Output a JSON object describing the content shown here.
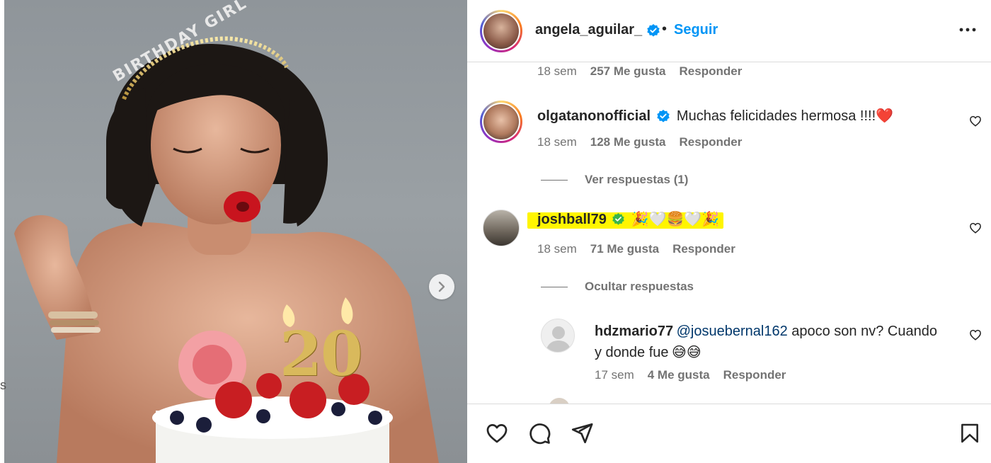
{
  "post": {
    "author": "angela_aguilar_",
    "dot": "•",
    "follow_label": "Seguir",
    "photo": {
      "crown_text": "BIRTHDAY GIRL",
      "candle_text": "20"
    }
  },
  "comments": {
    "top_meta": {
      "time": "18 sem",
      "likes": "257 Me gusta",
      "reply": "Responder"
    },
    "olga": {
      "user": "olgatanonofficial",
      "text": "Muchas felicidades hermosa !!!!",
      "emoji": "❤️",
      "time": "18 sem",
      "likes": "128 Me gusta",
      "reply": "Responder",
      "view_replies": "Ver respuestas (1)"
    },
    "josh": {
      "user": "joshball79",
      "emoji": "🎉🤍🍔🤍🎉",
      "time": "18 sem",
      "likes": "71 Me gusta",
      "reply": "Responder",
      "hide_replies": "Ocultar respuestas"
    },
    "mario": {
      "user": "hdzmario77",
      "mention": "@josuebernal162",
      "text_line1": " apoco son nv? Cuando",
      "text_line2": "y donde fue",
      "emoji": "😅😅",
      "time": "17 sem",
      "likes": "4 Me gusta",
      "reply": "Responder"
    }
  },
  "colors": {
    "accent_blue": "#0095f6",
    "verified_blue": "#0095f6",
    "verified_green": "#3bb54a",
    "highlight": "#fff500",
    "muted": "#737373"
  },
  "edge_char": "s"
}
